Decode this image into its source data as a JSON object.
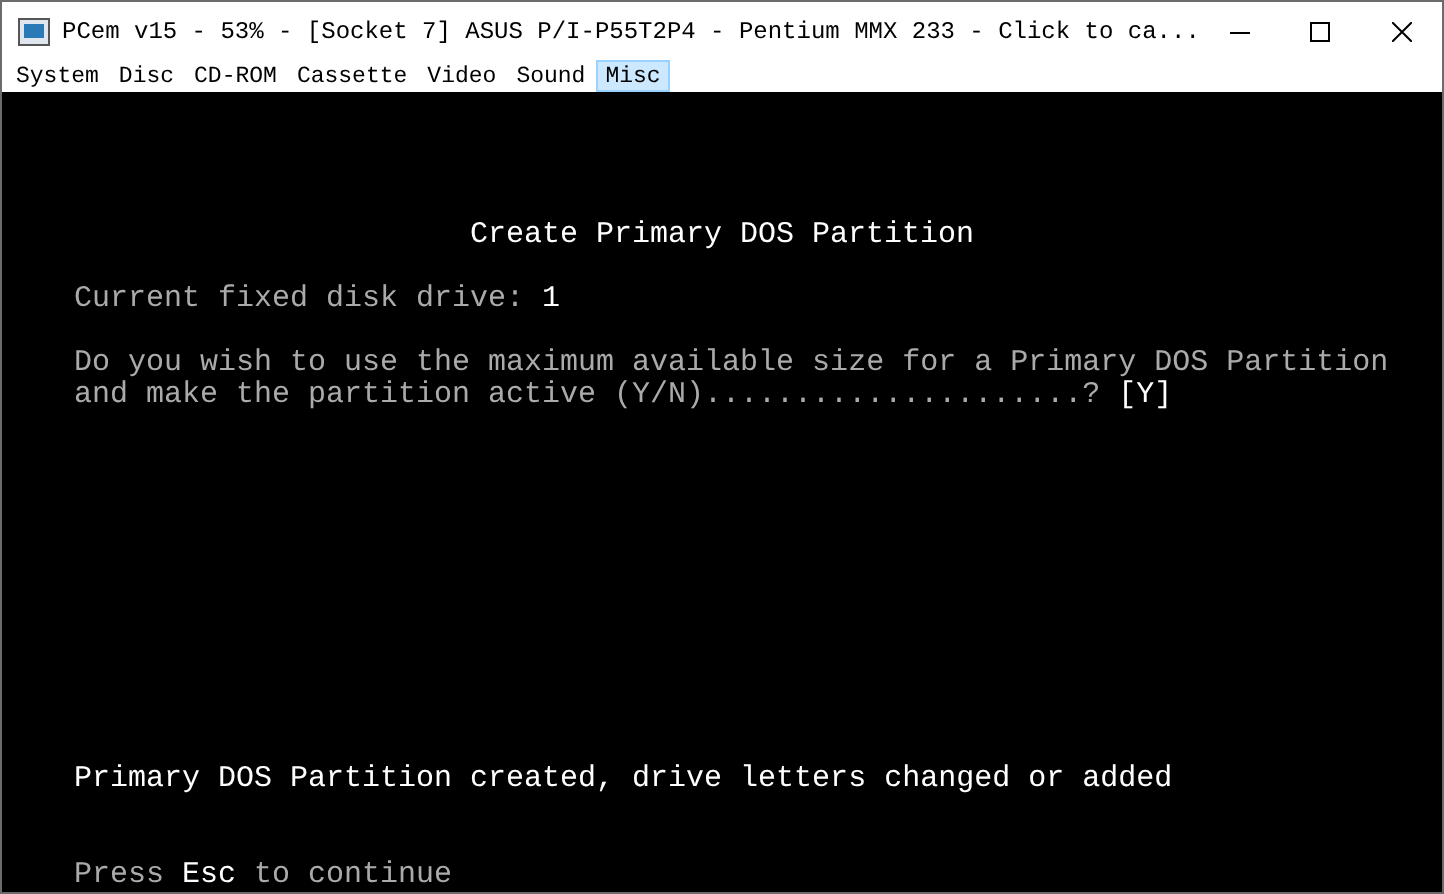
{
  "window": {
    "title": "PCem v15 - 53% - [Socket 7] ASUS P/I-P55T2P4 - Pentium MMX 233 - Click to ca..."
  },
  "menu": [
    {
      "label": "System",
      "selected": false
    },
    {
      "label": "Disc",
      "selected": false
    },
    {
      "label": "CD-ROM",
      "selected": false
    },
    {
      "label": "Cassette",
      "selected": false
    },
    {
      "label": "Video",
      "selected": false
    },
    {
      "label": "Sound",
      "selected": false
    },
    {
      "label": "Misc",
      "selected": true
    }
  ],
  "screen": [
    {
      "kind": "heading",
      "lines": [
        "Create Primary DOS Partition"
      ]
    },
    {
      "kind": "drive",
      "lines": [
        "Current fixed disk drive: **1**"
      ]
    },
    {
      "kind": "question",
      "lines": [
        "Do you wish to use the maximum available size for a Primary DOS Partition",
        "and make the partition active (Y/N).....................? **[Y]**"
      ]
    },
    {
      "kind": "status",
      "lines": [
        "Primary DOS Partition created, drive letters changed or added"
      ]
    },
    {
      "kind": "footer",
      "lines": [
        "Press **Esc** to continue"
      ]
    }
  ]
}
